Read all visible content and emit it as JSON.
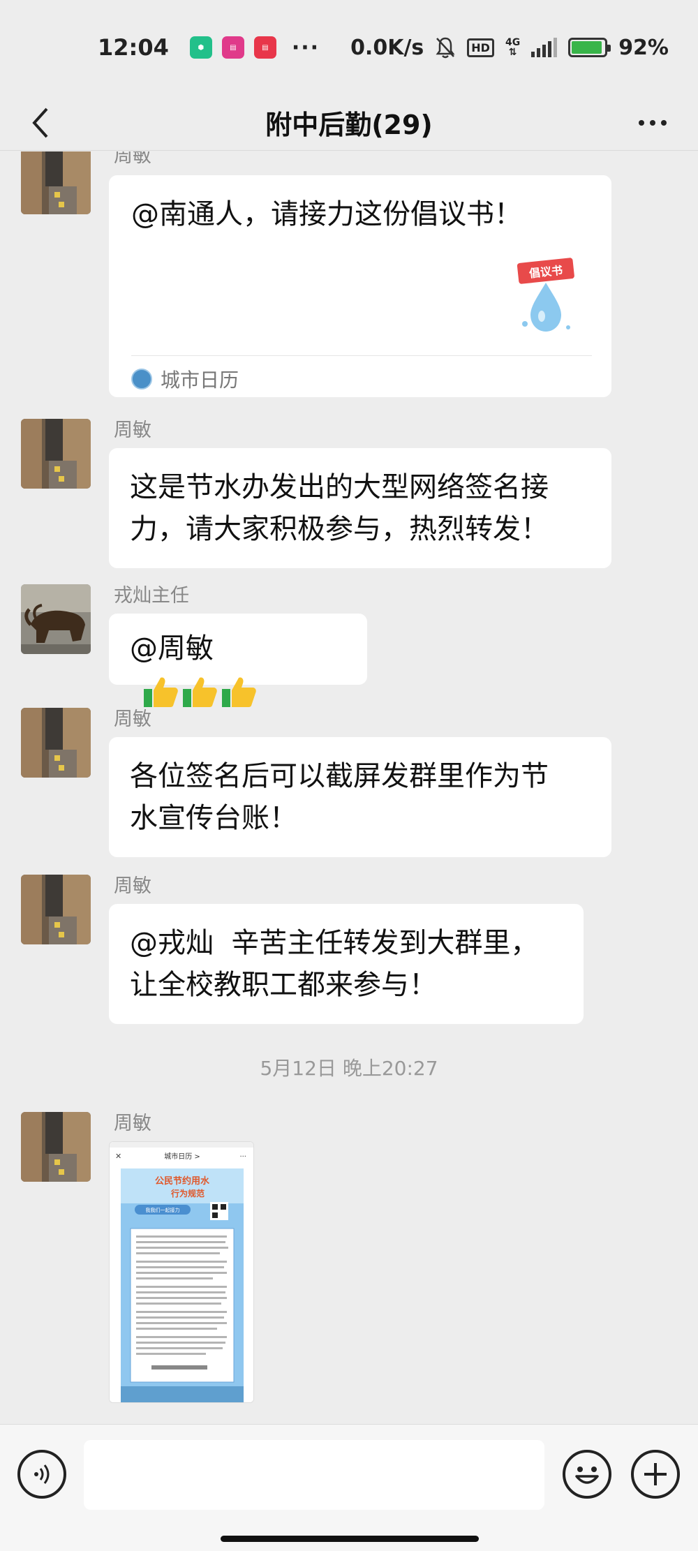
{
  "status_bar": {
    "time": "12:04",
    "network_speed": "0.0K/s",
    "hd": "HD",
    "network_type": "4G",
    "battery": "92%",
    "battery_level": 0.92,
    "more": "···"
  },
  "header": {
    "title": "附中后勤(29)"
  },
  "messages": [
    {
      "type": "link",
      "sender": "周敏",
      "title": "@南通人，请接力这份倡议书！",
      "thumb_text": "倡议书",
      "source": "城市日历"
    },
    {
      "type": "text",
      "sender": "周敏",
      "lines": [
        "这是节水办发出的大型网络签名接",
        "力，请大家积极参与，热烈转发！"
      ]
    },
    {
      "type": "text",
      "sender": "戎灿主任",
      "text": "@周敏"
    },
    {
      "type": "text",
      "sender": "周敏",
      "lines": [
        "各位签名后可以截屏发群里作为节",
        "水宣传台账！"
      ]
    },
    {
      "type": "text",
      "sender": "周敏",
      "lines": [
        "@戎灿  辛苦主任转发到大群里，",
        "让全校教职工都来参与！"
      ]
    },
    {
      "type": "image",
      "sender": "周敏",
      "header_left": "城市日历 >",
      "poster_title": "公民节约用水",
      "poster_subtitle": "行为规范",
      "poster_button": "我我们一起接力"
    }
  ],
  "timestamp": "5月12日 晚上20:27",
  "input": {
    "placeholder": ""
  },
  "colors": {
    "background": "#ededed",
    "bubble": "#ffffff",
    "thumb_green": "#2fa94a",
    "thumb_yellow": "#f7c22b"
  }
}
